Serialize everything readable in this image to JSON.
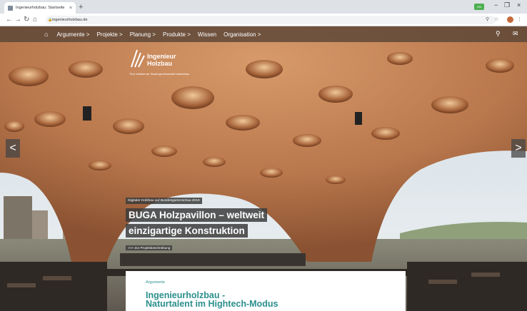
{
  "browser": {
    "tab_title": "Ingenieurholzbau: Startseite",
    "tab_close": "×",
    "new_tab": "+",
    "extension_label": "ON",
    "url": "ingenieurholzbau.de",
    "win_min": "−",
    "win_max": "❐",
    "win_close": "×"
  },
  "site_nav": {
    "items": [
      {
        "label": "Argumente >"
      },
      {
        "label": "Projekte >"
      },
      {
        "label": "Planung >"
      },
      {
        "label": "Produkte >"
      },
      {
        "label": "Wissen"
      },
      {
        "label": "Organisation >"
      }
    ]
  },
  "logo": {
    "name_line1": "Ingenieur",
    "name_line2": "Holzbau",
    "tagline": "Eine Initiative der Studiengemeinschaft Holzleimbau"
  },
  "slider": {
    "prev_label": "<",
    "next_label": ">",
    "kicker": "Digitaler Holzbau auf Bundesgartenschau 2019",
    "headline_line1": "BUGA Holzpavillon – weltweit",
    "headline_line2": "einzigartige Konstruktion",
    "link": ">>> Zur Projektbeschreibung"
  },
  "teaser": {
    "kicker": "Argumente",
    "title_line1": "Ingenieurholzbau -",
    "title_line2": "Naturtalent im Hightech-Modus"
  },
  "colors": {
    "accent": "#2a8f8c",
    "nav_bg": "#5a4637",
    "wood": "#b9774c"
  }
}
